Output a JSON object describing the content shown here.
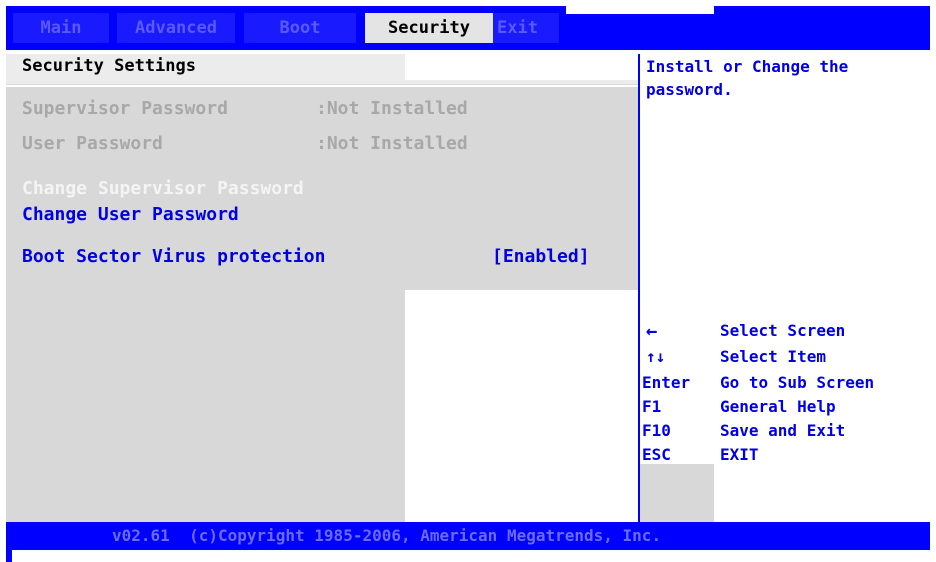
{
  "tabs": [
    {
      "label": "Main"
    },
    {
      "label": "Advanced"
    },
    {
      "label": "Boot"
    },
    {
      "label": "Security",
      "active": true
    },
    {
      "label": "Exit"
    }
  ],
  "section": {
    "title": "Security Settings"
  },
  "settings": {
    "supervisor_password_label": "Supervisor Password",
    "supervisor_password_value": ":Not Installed",
    "user_password_label": "User Password",
    "user_password_value": ":Not Installed",
    "change_supervisor_label": "Change Supervisor Password",
    "change_user_label": "Change User Password",
    "boot_sector_label": "Boot Sector Virus protection",
    "boot_sector_value": "[Enabled]"
  },
  "help": {
    "line1": "Install or Change the",
    "line2": "password."
  },
  "keys": [
    {
      "key": "←",
      "action": "Select Screen"
    },
    {
      "key": "↑↓",
      "action": "Select Item"
    },
    {
      "key": "Enter",
      "action": "Go to Sub Screen"
    },
    {
      "key": "F1",
      "action": "General Help"
    },
    {
      "key": "F10",
      "action": "Save and Exit"
    },
    {
      "key": "ESC",
      "action": "EXIT"
    }
  ],
  "footer": {
    "copyright": "v02.61  (c)Copyright 1985-2006, American Megatrends, Inc."
  },
  "colors": {
    "bios_blue": "#0000ff",
    "panel_gray": "#d8d8d8",
    "text_blue": "#0000e0"
  }
}
